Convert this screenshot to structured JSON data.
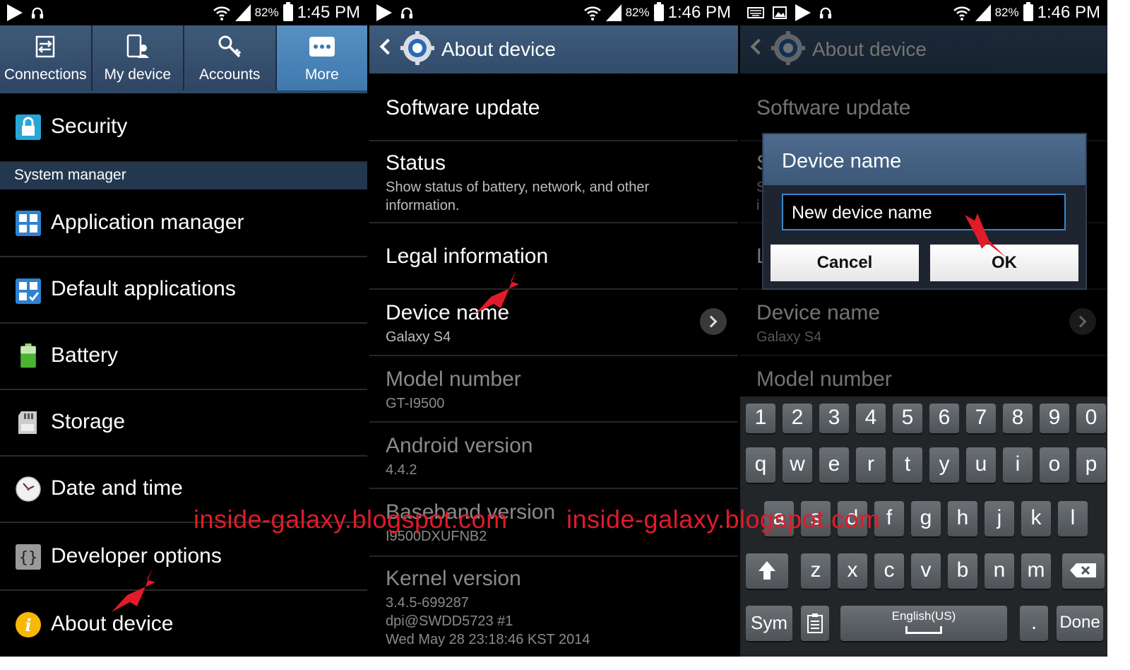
{
  "status_bars": [
    {
      "battery": "82%",
      "time": "1:45 PM"
    },
    {
      "battery": "82%",
      "time": "1:46 PM"
    },
    {
      "battery": "82%",
      "time": "1:46 PM"
    }
  ],
  "settings": {
    "tabs": [
      {
        "label": "Connections",
        "icon": "connections-icon"
      },
      {
        "label": "My device",
        "icon": "my-device-icon"
      },
      {
        "label": "Accounts",
        "icon": "accounts-icon"
      },
      {
        "label": "More",
        "icon": "more-icon",
        "active": true
      }
    ],
    "security": "Security",
    "section_header": "System manager",
    "items": [
      {
        "label": "Application manager",
        "icon": "application-manager-icon"
      },
      {
        "label": "Default applications",
        "icon": "default-applications-icon"
      },
      {
        "label": "Battery",
        "icon": "battery-icon"
      },
      {
        "label": "Storage",
        "icon": "storage-icon"
      },
      {
        "label": "Date and time",
        "icon": "clock-icon"
      },
      {
        "label": "Developer options",
        "icon": "developer-options-icon"
      },
      {
        "label": "About device",
        "icon": "info-icon"
      }
    ]
  },
  "about": {
    "title": "About device",
    "items": [
      {
        "title": "Software update",
        "sub": ""
      },
      {
        "title": "Status",
        "sub": "Show status of battery, network, and other information."
      },
      {
        "title": "Legal information",
        "sub": ""
      },
      {
        "title": "Device name",
        "sub": "Galaxy S4"
      },
      {
        "title": "Model number",
        "sub": "GT-I9500"
      },
      {
        "title": "Android version",
        "sub": "4.4.2"
      },
      {
        "title": "Baseband version",
        "sub": "I9500DXUFNB2"
      },
      {
        "title": "Kernel version",
        "sub": "3.4.5-699287\ndpi@SWDD5723 #1\nWed May 28 23:18:46 KST 2014"
      }
    ]
  },
  "bg": {
    "title": "About device",
    "software_update": "Software update",
    "s_fragment": "S",
    "s_fragment2": "S",
    "i_fragment": "i",
    "l_fragment": "L",
    "device_name": "Device name",
    "device_name_sub": "Galaxy S4",
    "model_number": "Model number"
  },
  "dialog": {
    "title": "Device name",
    "input_value": "New device name",
    "cancel": "Cancel",
    "ok": "OK"
  },
  "keyboard": {
    "numbers": [
      "1",
      "2",
      "3",
      "4",
      "5",
      "6",
      "7",
      "8",
      "9",
      "0"
    ],
    "row1": [
      "q",
      "w",
      "e",
      "r",
      "t",
      "y",
      "u",
      "i",
      "o",
      "p"
    ],
    "row2": [
      "a",
      "s",
      "d",
      "f",
      "g",
      "h",
      "j",
      "k",
      "l"
    ],
    "row3": [
      "z",
      "x",
      "c",
      "v",
      "b",
      "n",
      "m"
    ],
    "sym": "Sym",
    "language": "English(US)",
    "period": ".",
    "done": "Done"
  },
  "watermark": "inside-galaxy.blogspot.com",
  "colors": {
    "accent": "#3e78ad",
    "arrow": "#e01b2a",
    "watermark": "#e01b2a"
  }
}
